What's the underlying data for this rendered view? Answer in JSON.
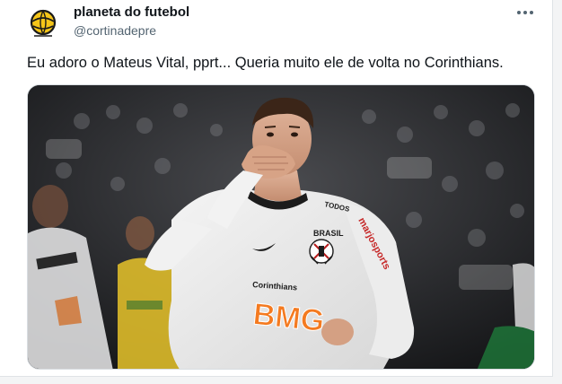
{
  "post": {
    "author_name": "planeta do futebol",
    "author_handle": "@cortinadepre",
    "more_icon": "more-horizontal-icon",
    "text": "Eu adoro o Mateus Vital, pprt... Queria muito ele de volta no Corinthians.",
    "media": {
      "description_icon": "photo",
      "jersey_texts": {
        "sponsor_main": "BMG",
        "sponsor_chest": "Corinthians",
        "sleeve": "marjosports",
        "brasil": "BRASIL",
        "todos": "TODOS"
      }
    }
  },
  "colors": {
    "text_primary": "#0f1419",
    "text_secondary": "#536471",
    "sponsor_orange": "#f47a20"
  }
}
